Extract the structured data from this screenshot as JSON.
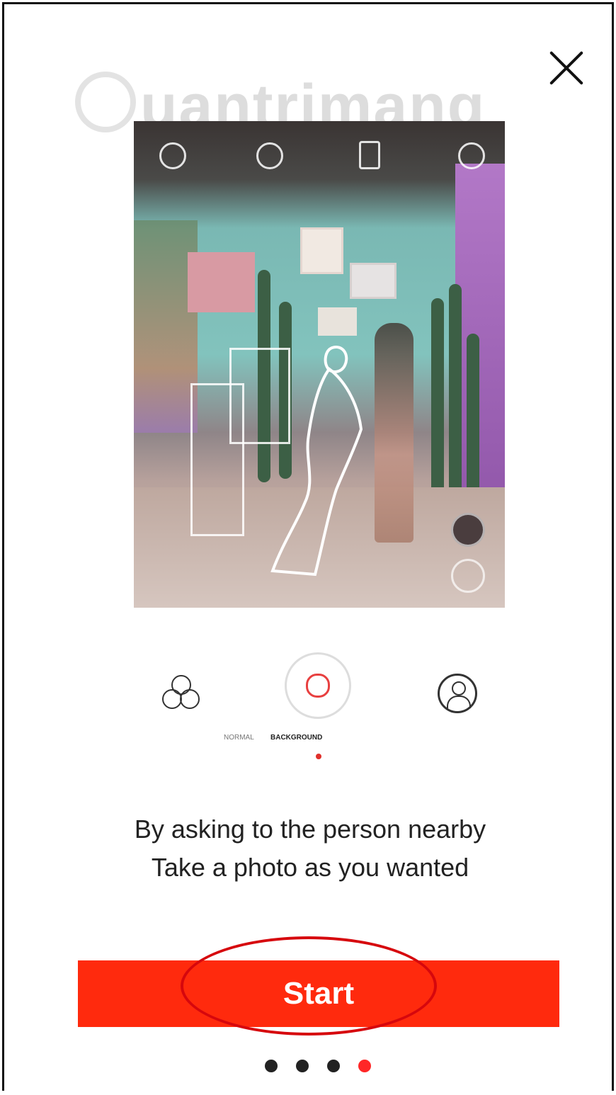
{
  "watermark": {
    "text": "uantrimang"
  },
  "preview": {
    "top_tools": [
      "landscape-icon",
      "more-icon",
      "face-frame-icon",
      "rotate-camera-icon"
    ],
    "side_buttons": [
      "swap-icon",
      "shutter-icon"
    ]
  },
  "modes": {
    "items": [
      {
        "label": "NORMAL",
        "icon": "triple-circle-icon"
      },
      {
        "label": "BACKGROUND",
        "icon": "background-outline-icon",
        "selected": true
      },
      {
        "label": "",
        "icon": "portrait-icon"
      }
    ]
  },
  "description": {
    "line1": "By asking to the person nearby",
    "line2": "Take a photo as you wanted"
  },
  "start_label": "Start",
  "pager": {
    "count": 4,
    "active_index": 3
  },
  "colors": {
    "accent": "#ff2a0d",
    "annotation": "#d6070d",
    "dot_active": "#ff2727"
  }
}
